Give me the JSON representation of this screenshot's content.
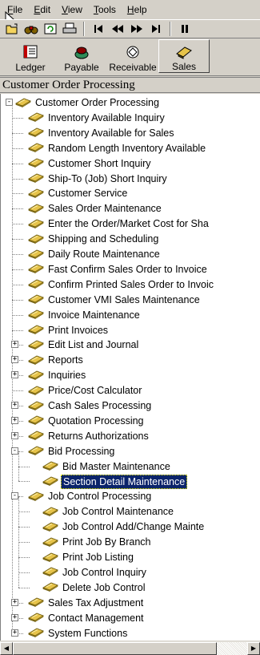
{
  "menubar": {
    "items": [
      {
        "label": "File",
        "underline": "F",
        "rest": "ile"
      },
      {
        "label": "Edit",
        "underline": "E",
        "rest": "dit"
      },
      {
        "label": "View",
        "underline": "V",
        "rest": "iew"
      },
      {
        "label": "Tools",
        "underline": "T",
        "rest": "ools"
      },
      {
        "label": "Help",
        "underline": "H",
        "rest": "elp"
      }
    ]
  },
  "toolbar": {
    "icons": [
      "open-icon",
      "binoculars-icon",
      "refresh-icon",
      "print-icon",
      "first-record-icon",
      "previous-record-icon",
      "next-record-icon",
      "last-record-icon",
      "pause-icon"
    ]
  },
  "shortcuts": [
    {
      "label": "Ledger",
      "icon": "ledger-icon"
    },
    {
      "label": "Payable",
      "icon": "payable-icon"
    },
    {
      "label": "Receivable",
      "icon": "receivable-icon"
    },
    {
      "label": "Sales",
      "icon": "sales-icon",
      "active": true
    }
  ],
  "panel": {
    "title": "Customer Order Processing"
  },
  "tree": [
    {
      "label": "Customer Order Processing",
      "level": 0,
      "expander": "-"
    },
    {
      "label": "Inventory Available Inquiry",
      "level": 1
    },
    {
      "label": "Inventory Available for Sales",
      "level": 1
    },
    {
      "label": "Random Length Inventory Available",
      "level": 1
    },
    {
      "label": "Customer Short Inquiry",
      "level": 1
    },
    {
      "label": "Ship-To (Job) Short Inquiry",
      "level": 1
    },
    {
      "label": "Customer Service",
      "level": 1
    },
    {
      "label": "Sales Order Maintenance",
      "level": 1
    },
    {
      "label": "Enter the Order/Market Cost for Sha",
      "level": 1
    },
    {
      "label": "Shipping and Scheduling",
      "level": 1
    },
    {
      "label": "Daily Route Maintenance",
      "level": 1
    },
    {
      "label": "Fast Confirm Sales Order to Invoice",
      "level": 1
    },
    {
      "label": "Confirm Printed Sales Order to Invoic",
      "level": 1
    },
    {
      "label": "Customer VMI Sales Maintenance",
      "level": 1
    },
    {
      "label": "Invoice Maintenance",
      "level": 1
    },
    {
      "label": "Print Invoices",
      "level": 1
    },
    {
      "label": "Edit List and Journal",
      "level": 1,
      "expander": "+"
    },
    {
      "label": "Reports",
      "level": 1,
      "expander": "+"
    },
    {
      "label": "Inquiries",
      "level": 1,
      "expander": "+"
    },
    {
      "label": "Price/Cost Calculator",
      "level": 1
    },
    {
      "label": "Cash Sales Processing",
      "level": 1,
      "expander": "+"
    },
    {
      "label": "Quotation Processing",
      "level": 1,
      "expander": "+"
    },
    {
      "label": "Returns Authorizations",
      "level": 1,
      "expander": "+"
    },
    {
      "label": "Bid Processing",
      "level": 1,
      "expander": "-"
    },
    {
      "label": "Bid Master Maintenance",
      "level": 2
    },
    {
      "label": "Section Detail Maintenance",
      "level": 2,
      "selected": true
    },
    {
      "label": "Job Control Processing",
      "level": 1,
      "expander": "-"
    },
    {
      "label": "Job Control Maintenance",
      "level": 2
    },
    {
      "label": "Job Control Add/Change Mainte",
      "level": 2
    },
    {
      "label": "Print Job By Branch",
      "level": 2
    },
    {
      "label": "Print Job Listing",
      "level": 2
    },
    {
      "label": "Job Control Inquiry",
      "level": 2
    },
    {
      "label": "Delete Job Control",
      "level": 2
    },
    {
      "label": "Sales Tax Adjustment",
      "level": 1,
      "expander": "+"
    },
    {
      "label": "Contact Management",
      "level": 1,
      "expander": "+"
    },
    {
      "label": "System Functions",
      "level": 1,
      "expander": "+"
    }
  ],
  "scrollbar": {
    "left_arrow": "◀",
    "right_arrow": "▶"
  }
}
